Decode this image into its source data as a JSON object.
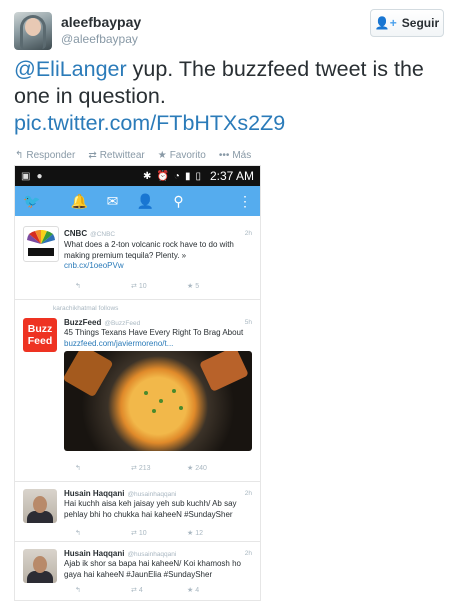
{
  "tweet": {
    "name": "aleefbaypay",
    "handle": "@aleefbaypay",
    "follow_label": "Seguir",
    "follow_icon": "user-plus-icon",
    "mention": "@EliLanger",
    "text_1": " yup. The buzzfeed tweet is the one in question.",
    "link": "pic.twitter.com/FTbHTXs2Z9",
    "actions": {
      "reply": "Responder",
      "retweet": "Retwittear",
      "favorite": "Favorito",
      "more": "Más"
    }
  },
  "phone": {
    "status_time": "2:37 AM",
    "appbar_icons": [
      "twitter-bird-icon",
      "notifications-icon",
      "messages-icon",
      "add-user-icon",
      "search-icon",
      "more-icon"
    ],
    "accent": "#55acee",
    "timeline": [
      {
        "name": "CNBC",
        "handle": "@CNBC",
        "time": "2h",
        "text": "What does a 2-ton volcanic rock have to do with making premium tequila? Plenty. »",
        "link": "cnb.cx/1oeoPVw",
        "retweets": "10",
        "favorites": "5"
      },
      {
        "follows": "karachikhatmal follows",
        "name": "BuzzFeed",
        "handle": "@BuzzFeed",
        "time": "5h",
        "logo_line1": "Buzz",
        "logo_line2": "Feed",
        "text": "45 Things Texans Have Every Right To Brag About ",
        "link": "buzzfeed.com/javiermoreno/t...",
        "retweets": "213",
        "favorites": "240"
      },
      {
        "name": "Husain Haqqani",
        "handle": "@husainhaqqani",
        "time": "2h",
        "text": "Hai kuchh aisa keh jaisay yeh sub kuchh/ Ab say pehlay bhi ho chukka hai kaheeN #SundaySher",
        "retweets": "10",
        "favorites": "12"
      },
      {
        "name": "Husain Haqqani",
        "handle": "@husainhaqqani",
        "time": "2h",
        "text": "Ajab ik shor sa bapa hai kaheeN/ Koi khamosh ho gaya hai kaheeN #JaunElia #SundaySher",
        "retweets": "4",
        "favorites": "4"
      }
    ]
  }
}
